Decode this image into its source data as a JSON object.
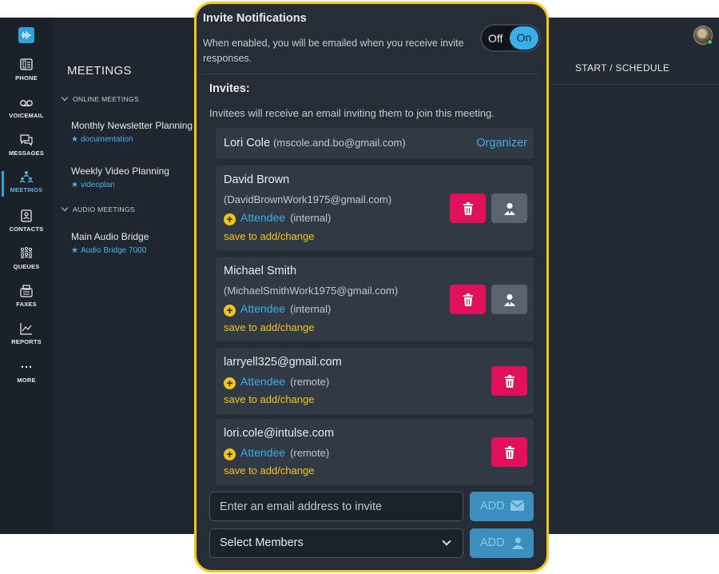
{
  "nav": {
    "items": [
      {
        "label": "PHONE",
        "icon": "phone-icon"
      },
      {
        "label": "VOICEMAIL",
        "icon": "voicemail-icon"
      },
      {
        "label": "MESSAGES",
        "icon": "messages-icon"
      },
      {
        "label": "MEETINGS",
        "icon": "meetings-icon",
        "active": true
      },
      {
        "label": "CONTACTS",
        "icon": "contacts-icon"
      },
      {
        "label": "QUEUES",
        "icon": "queues-icon"
      },
      {
        "label": "FAXES",
        "icon": "fax-icon"
      },
      {
        "label": "REPORTS",
        "icon": "reports-icon"
      },
      {
        "label": "MORE",
        "icon": "more-icon"
      }
    ]
  },
  "meetings": {
    "title": "MEETINGS",
    "online_group": "ONLINE MEETINGS",
    "audio_group": "AUDIO MEETINGS",
    "online": [
      {
        "name": "Monthly Newsletter Planning",
        "tag": "documentation"
      },
      {
        "name": "Weekly Video Planning",
        "tag": "videoplan"
      }
    ],
    "audio": [
      {
        "name": "Main Audio Bridge",
        "tag": "Audio Bridge 7000"
      }
    ]
  },
  "header": {
    "start_schedule": "START / SCHEDULE"
  },
  "popup": {
    "title": "Invite Notifications",
    "description": "When enabled, you will be emailed when you receive invite responses.",
    "toggle_off": "Off",
    "toggle_on": "On",
    "toggle_state": "On",
    "invites_heading": "Invites:",
    "invites_sub": "Invitees will receive an email inviting them to join this meeting.",
    "organizer": {
      "name": "Lori Cole",
      "email": "(mscole.and.bo@gmail.com)",
      "role": "Organizer"
    },
    "invitees": [
      {
        "name": "David Brown",
        "email": "(DavidBrownWork1975@gmail.com)",
        "role": "Attendee",
        "type": "(internal)",
        "save": "save to add/change"
      },
      {
        "name": "Michael Smith",
        "email": "(MichaelSmithWork1975@gmail.com)",
        "role": "Attendee",
        "type": "(internal)",
        "save": "save to add/change"
      },
      {
        "name": "larryell325@gmail.com",
        "role": "Attendee",
        "type": "(remote)",
        "save": "save to add/change"
      },
      {
        "name": "lori.cole@intulse.com",
        "role": "Attendee",
        "type": "(remote)",
        "save": "save to add/change"
      }
    ],
    "email_input_placeholder": "Enter an email address to invite",
    "add_label": "ADD",
    "select_members": "Select Members"
  },
  "colors": {
    "accent": "#3aaee8",
    "highlight": "#f5c518",
    "delete": "#e0105a"
  }
}
